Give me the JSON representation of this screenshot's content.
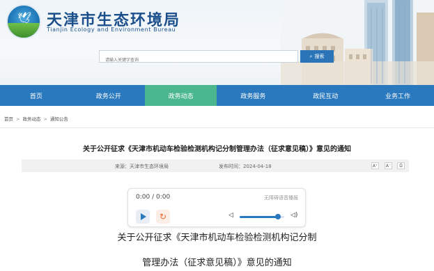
{
  "site": {
    "title": "天津市生态环境局",
    "subtitle": "Tianjin Ecology and Environment Bureau"
  },
  "search": {
    "placeholder": "请输入关键字查询",
    "button_label": "搜索"
  },
  "nav": {
    "items": [
      {
        "label": "首页"
      },
      {
        "label": "政务公开"
      },
      {
        "label": "政务动态"
      },
      {
        "label": "政务服务"
      },
      {
        "label": "政民互动"
      },
      {
        "label": "业务工作"
      }
    ],
    "active_index": 2
  },
  "breadcrumb": [
    "首页",
    "政务动态",
    "通知公告"
  ],
  "article": {
    "title": "关于公开征求《天津市机动车检验检测机构记分制管理办法（征求意见稿）》意见的通知",
    "source_label": "来源：天津市生态环境局",
    "date_label": "发布时间：2024-04-18",
    "font_buttons": [
      "A⁺",
      "A⁻",
      "⎙"
    ]
  },
  "player": {
    "time": "0:00 / 0:00",
    "free_tag": "无障碍语音播报",
    "volume": 0.86
  },
  "body": {
    "title_line1": "关于公开征求《天津市机动车检验检测机构记分制",
    "title_line2": "管理办法（征求意见稿）》意见的通知"
  },
  "colors": {
    "nav_bg": "#2a78bd",
    "nav_active": "#4bb78f",
    "brand_text": "#1a4f8c"
  }
}
